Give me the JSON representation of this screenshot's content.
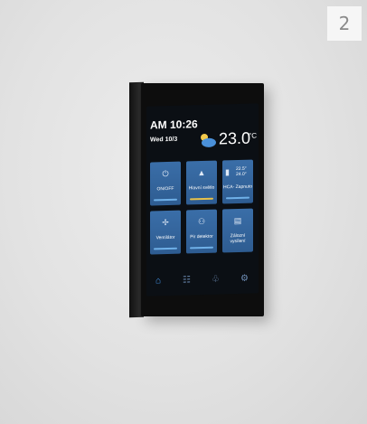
{
  "badge": "2",
  "status": {
    "time": "AM 10:26",
    "date": "Wed 10/3",
    "temperature": "23.0",
    "temperature_unit": "°C"
  },
  "tiles": [
    {
      "label": "ON/OFF",
      "icon": "power-icon"
    },
    {
      "label": "Hlavní světlo",
      "icon": "lamp-icon"
    },
    {
      "label": "HCA- Zapnuto",
      "icon": "thermostat-icon",
      "value_main": "22.5°",
      "value_sub": "24.0°"
    },
    {
      "label": "Ventilátor",
      "icon": "fan-icon"
    },
    {
      "label": "Pir detektor",
      "icon": "motion-sensor-icon"
    },
    {
      "label": "Zálozní vysílení",
      "icon": "backup-transmitter-icon"
    }
  ],
  "nav": [
    {
      "icon": "home-icon",
      "active": true
    },
    {
      "icon": "rooms-icon",
      "active": false
    },
    {
      "icon": "scenes-icon",
      "active": false
    },
    {
      "icon": "settings-icon",
      "active": false
    }
  ]
}
